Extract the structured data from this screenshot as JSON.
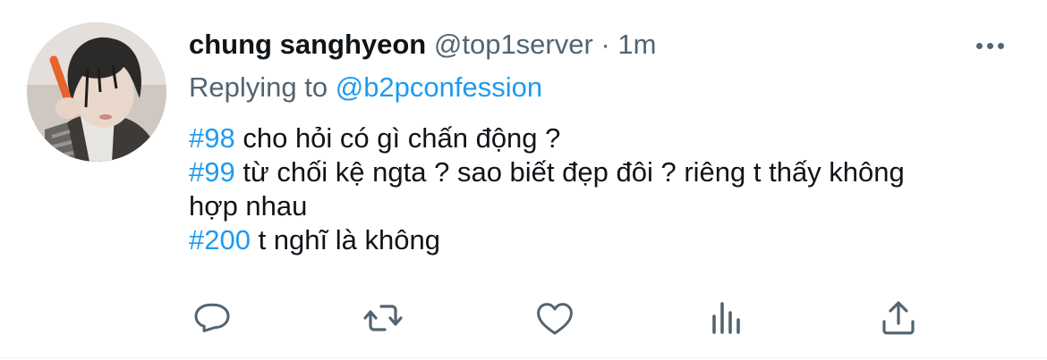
{
  "tweet": {
    "author_name": "chung sanghyeon",
    "author_handle": "@top1server",
    "separator": "·",
    "timestamp": "1m",
    "replying_prefix": "Replying to",
    "replying_handle": "@b2pconfession",
    "lines": [
      {
        "tag": "#98",
        "text": " cho hỏi có gì chấn động ?"
      },
      {
        "tag": "#99",
        "text": " từ chối kệ ngta ? sao biết đẹp đôi ? riêng t thấy không"
      },
      {
        "tag": "",
        "text": "hợp nhau"
      },
      {
        "tag": "#200",
        "text": " t nghĩ là không"
      }
    ]
  },
  "icons": {
    "more": "more-horizontal-icon",
    "reply": "reply-bubble-icon",
    "retweet": "retweet-icon",
    "like": "heart-icon",
    "analytics": "analytics-bars-icon",
    "share": "share-upload-icon"
  },
  "colors": {
    "accent": "#1d9bf0",
    "text": "#0f1419",
    "secondary": "#536471"
  }
}
